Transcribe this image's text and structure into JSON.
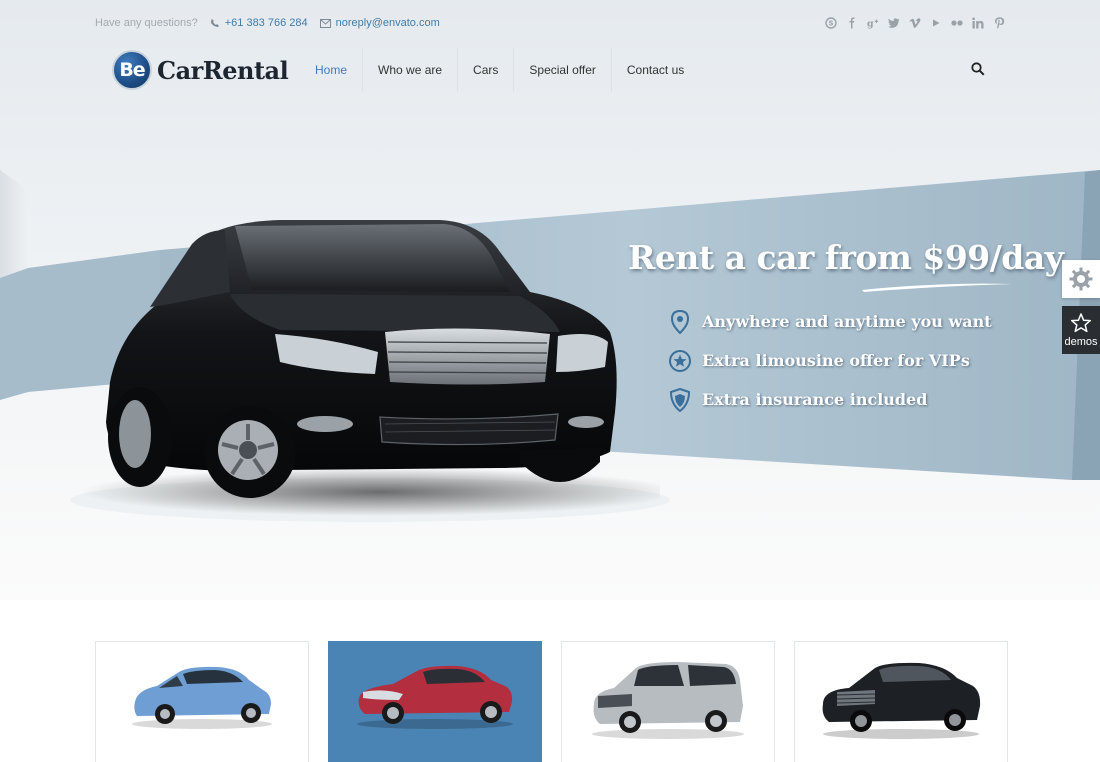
{
  "topbar": {
    "question": "Have any questions?",
    "phone": "+61 383 766 284",
    "email": "noreply@envato.com",
    "socials": [
      "skype-icon",
      "facebook-icon",
      "google-plus-icon",
      "twitter-icon",
      "vimeo-icon",
      "youtube-icon",
      "flickr-icon",
      "linkedin-icon",
      "pinterest-icon"
    ]
  },
  "logo": {
    "badge": "Be",
    "name": "CarRental"
  },
  "nav": [
    {
      "label": "Home",
      "active": true
    },
    {
      "label": "Who we are"
    },
    {
      "label": "Cars"
    },
    {
      "label": "Special offer"
    },
    {
      "label": "Contact us"
    }
  ],
  "hero": {
    "headline": "Rent a car from $99/day",
    "features": [
      {
        "icon": "map-pin-icon",
        "text": "Anywhere and anytime you want"
      },
      {
        "icon": "star-badge-icon",
        "text": "Extra limousine offer for VIPs"
      },
      {
        "icon": "shield-icon",
        "text": "Extra insurance included"
      }
    ]
  },
  "side": {
    "demos_label": "demos"
  },
  "cards": [
    {
      "car": "blue-hatchback",
      "color": "#6f9ed4"
    },
    {
      "car": "red-sedan",
      "color": "#b32e3f",
      "selected": true
    },
    {
      "car": "silver-minivan",
      "color": "#b7bcc1"
    },
    {
      "car": "black-sedan",
      "color": "#1d2024"
    }
  ],
  "colors": {
    "accent": "#3a7cbf",
    "band": "#a6bdcc",
    "selected_card": "#4a84b4"
  }
}
